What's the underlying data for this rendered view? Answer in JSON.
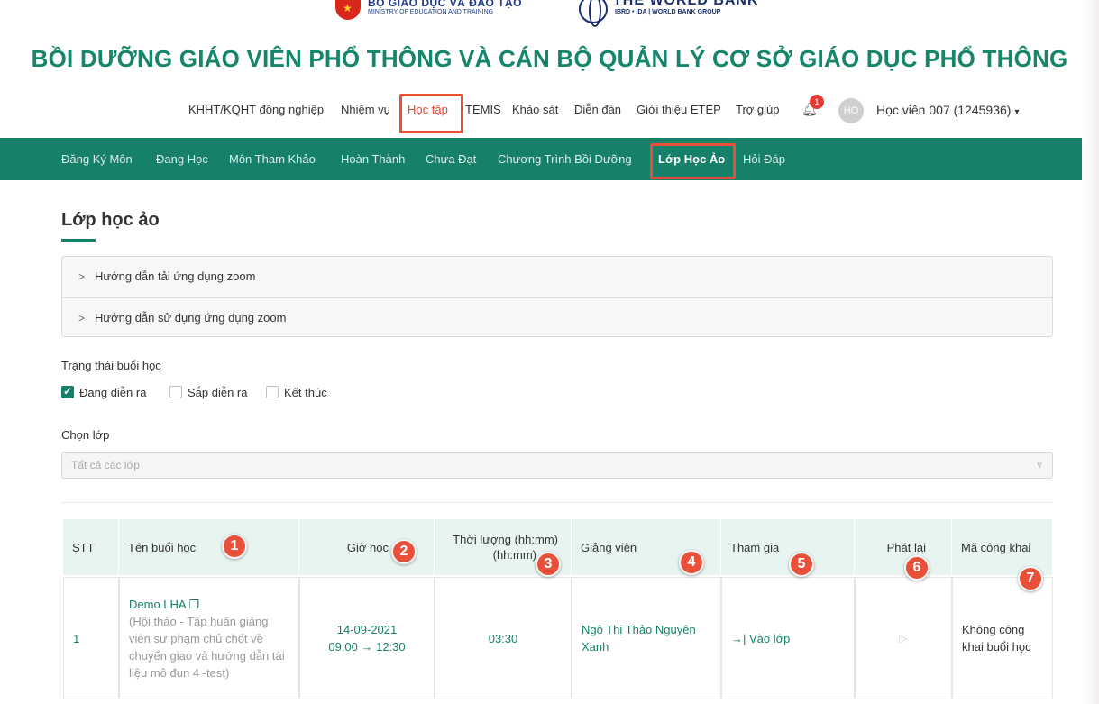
{
  "header": {
    "moet_name": "BỘ GIÁO DỤC VÀ ĐÀO TẠO",
    "moet_sub": "MINISTRY OF EDUCATION AND TRAINING",
    "wb_name": "THE WORLD BANK",
    "wb_sub": "IBRD • IDA | WORLD BANK GROUP",
    "title": "BỒI DƯỠNG GIÁO VIÊN PHỔ THÔNG VÀ CÁN BỘ QUẢN LÝ CƠ SỞ GIÁO DỤC PHỔ THÔNG"
  },
  "topnav": {
    "items": [
      "KHHT/KQHT đồng nghiệp",
      "Nhiệm vụ",
      "Học tập",
      "TEMIS",
      "Khảo sát",
      "Diễn đàn",
      "Giới thiệu ETEP",
      "Trợ giúp"
    ],
    "active": "Học tập",
    "notification_count": "1",
    "avatar_initials": "HO",
    "user_name": "Học viên 007 (1245936)",
    "caret": "▾"
  },
  "subnav": {
    "items": [
      "Đăng Ký Môn",
      "Đang Học",
      "Môn Tham Khảo",
      "Hoàn Thành",
      "Chưa Đạt",
      "Chương Trình Bồi Dưỡng",
      "Lớp Học Ảo",
      "Hỏi Đáp"
    ],
    "active": "Lớp Học Ảo"
  },
  "page": {
    "title": "Lớp học ảo",
    "accordion": [
      "Hướng dẫn tải ứng dụng zoom",
      "Hướng dẫn sử dụng ứng dụng zoom"
    ],
    "status_label": "Trạng thái buổi học",
    "status_options": [
      {
        "label": "Đang diễn ra",
        "checked": true
      },
      {
        "label": "Sắp diễn ra",
        "checked": false
      },
      {
        "label": "Kết thúc",
        "checked": false
      }
    ],
    "class_label": "Chọn lớp",
    "class_placeholder": "Tất cả các lớp"
  },
  "table": {
    "headers": {
      "stt": "STT",
      "session_name": "Tên buổi học",
      "time": "Giờ học",
      "duration": "Thời lượng (hh:mm)",
      "duration_unit": "(hh:mm)",
      "teacher": "Giảng viên",
      "join": "Tham gia",
      "replay": "Phát lại",
      "public_code": "Mã công khai"
    },
    "rows": [
      {
        "stt": "1",
        "session_title": "Demo LHA",
        "session_desc": "(Hội thảo - Tập huấn giảng viên sư phạm chủ chốt về chuyển giao và hướng dẫn tài liệu mô đun 4 -test)",
        "date": "14-09-2021",
        "time_range": "09:00 → 12:30",
        "duration": "03:30",
        "teacher": "Ngô Thị Thảo Nguyên Xanh",
        "join_label": "Vào lớp",
        "public_code": "Không công khai buổi học"
      }
    ]
  },
  "markers": [
    "1",
    "2",
    "3",
    "4",
    "5",
    "6",
    "7"
  ],
  "colors": {
    "brand_green": "#17806b",
    "title_green": "#15856b",
    "highlight_red": "#e8503a",
    "header_bg": "#e8f4f1"
  }
}
